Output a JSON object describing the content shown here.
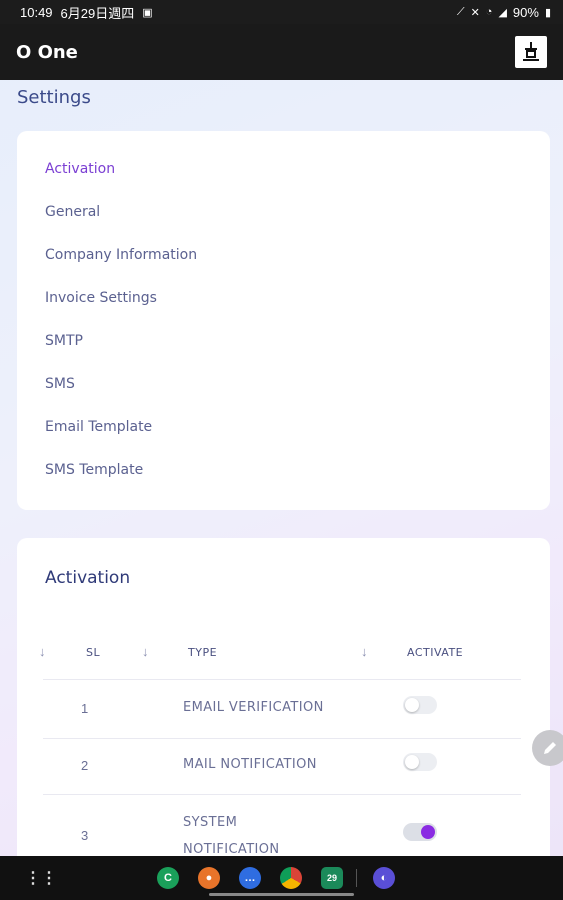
{
  "status_bar": {
    "time": "10:49",
    "date": "6月29日週四",
    "battery": "90%"
  },
  "app_bar": {
    "title": "O One",
    "logo_icon": "company-logo-icon"
  },
  "page": {
    "title": "Settings"
  },
  "settings_menu": {
    "items": [
      {
        "label": "Activation",
        "active": true
      },
      {
        "label": "General",
        "active": false
      },
      {
        "label": "Company Information",
        "active": false
      },
      {
        "label": "Invoice Settings",
        "active": false
      },
      {
        "label": "SMTP",
        "active": false
      },
      {
        "label": "SMS",
        "active": false
      },
      {
        "label": "Email Template",
        "active": false
      },
      {
        "label": "SMS Template",
        "active": false
      }
    ]
  },
  "activation": {
    "title": "Activation",
    "columns": {
      "sl": "SL",
      "type": "TYPE",
      "activate": "ACTIVATE"
    },
    "rows": [
      {
        "sl": "1",
        "type": "EMAIL VERIFICATION",
        "activated": false
      },
      {
        "sl": "2",
        "type": "MAIL NOTIFICATION",
        "activated": false
      },
      {
        "sl": "3",
        "type_line1": "SYSTEM",
        "type_line2": "NOTIFICATION",
        "activated": true
      }
    ]
  },
  "colors": {
    "accent": "#7b3fd3",
    "toggle_on": "#8a2be2",
    "app_bar": "#1a1a1a"
  }
}
